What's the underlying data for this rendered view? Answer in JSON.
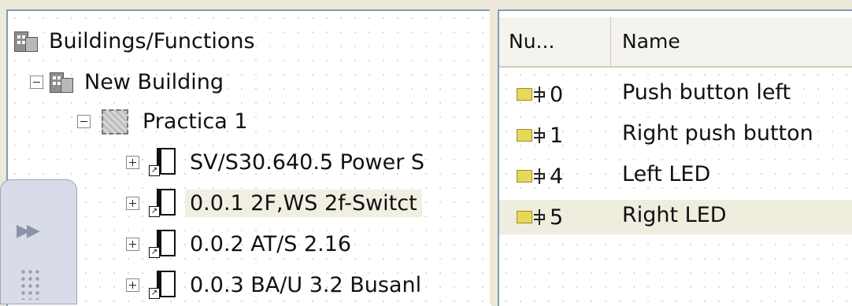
{
  "tree": {
    "root": {
      "label": "Buildings/Functions",
      "icon": "buildings-icon"
    },
    "building": {
      "label": "New Building",
      "icon": "building-icon"
    },
    "room": {
      "label": "Practica 1",
      "icon": "room-icon"
    },
    "devices": [
      {
        "label": "SV/S30.640.5 Power S",
        "icon": "device-icon"
      },
      {
        "label": "0.0.1 2F,WS 2f-Switct",
        "icon": "device-icon",
        "selected": true
      },
      {
        "label": "0.0.2 AT/S 2.16",
        "icon": "device-icon"
      },
      {
        "label": "0.0.3 BA/U 3.2 Busanl",
        "icon": "device-icon"
      }
    ]
  },
  "list": {
    "columns": [
      "Nu...",
      "Name"
    ],
    "rows": [
      {
        "num": "0",
        "name": "Push button left",
        "icon": "group-object-icon"
      },
      {
        "num": "1",
        "name": "Right push button",
        "icon": "group-object-icon"
      },
      {
        "num": "4",
        "name": "Left LED",
        "icon": "group-object-icon"
      },
      {
        "num": "5",
        "name": "Right LED",
        "icon": "group-object-icon",
        "selected": true
      }
    ]
  },
  "colors": {
    "selection": "#eeedde",
    "border": "#7f9db9",
    "object_icon": "#e8d85a"
  }
}
